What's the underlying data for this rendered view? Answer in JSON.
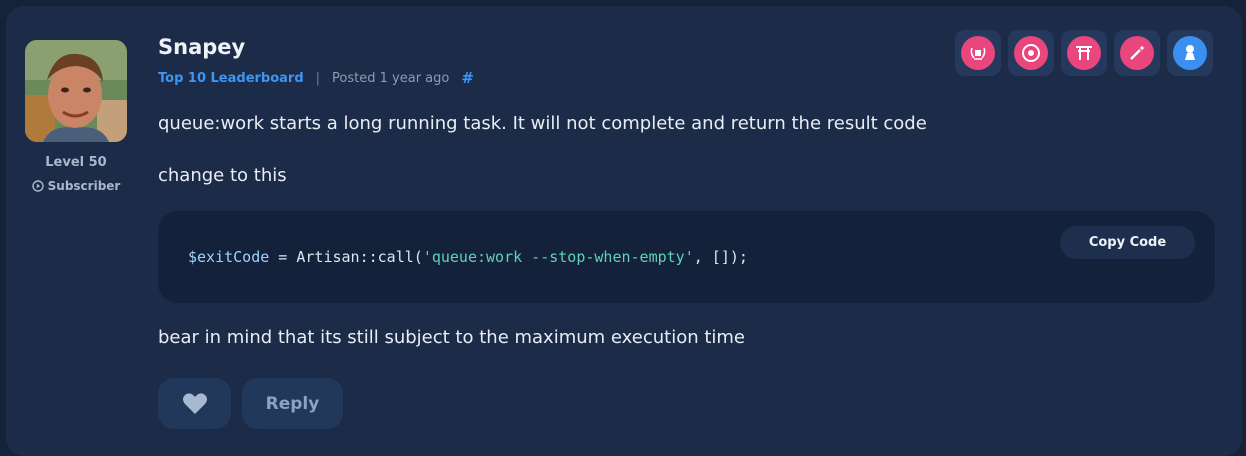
{
  "post": {
    "author": "Snapey",
    "rank": "Top 10 Leaderboard",
    "separator": "|",
    "posted": "Posted 1 year ago",
    "permalink": "#",
    "level": "Level 50",
    "subscriber": "Subscriber",
    "avatar_icon": "user-avatar-photo",
    "paragraphs": [
      "queue:work starts a long running task. It will not complete and return the result code",
      "change to this",
      "bear in mind that its still subject to the maximum execution time"
    ],
    "code": {
      "var": "$exitCode",
      "op": " = Artisan::call(",
      "str": "'queue:work --stop-when-empty'",
      "rest": ", []);",
      "copy_label": "Copy Code"
    },
    "badges": [
      {
        "icon": "laurel-badge-icon",
        "color": "#e8467c"
      },
      {
        "icon": "flower-badge-icon",
        "color": "#e8467c"
      },
      {
        "icon": "torii-gate-badge-icon",
        "color": "#e8467c"
      },
      {
        "icon": "magic-wand-badge-icon",
        "color": "#e8467c"
      },
      {
        "icon": "doll-badge-icon",
        "color": "#3b8ff0"
      }
    ],
    "actions": {
      "like_icon": "heart-icon",
      "reply_label": "Reply"
    }
  },
  "colors": {
    "background": "#152238",
    "card": "#1c2c48",
    "accent": "#3d95f5",
    "badge_pink": "#e8467c",
    "badge_blue": "#3b8ff0"
  }
}
